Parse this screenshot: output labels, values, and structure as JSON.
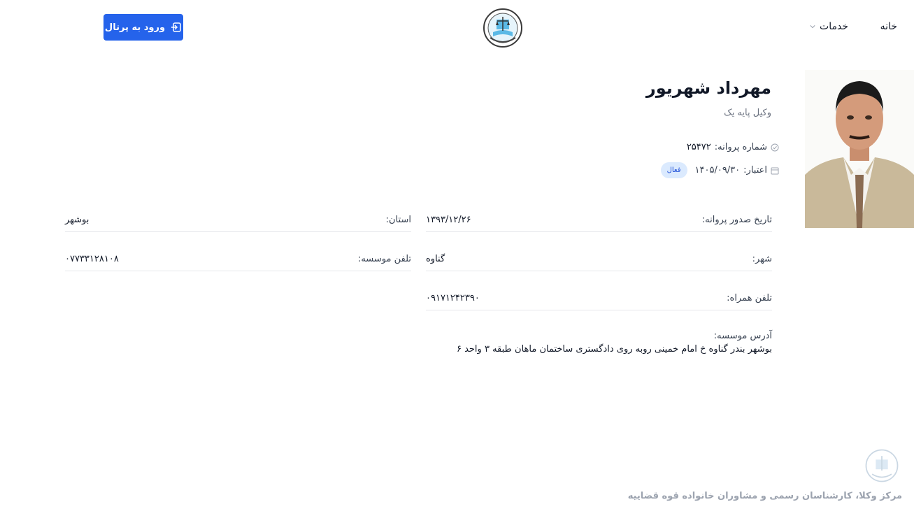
{
  "header": {
    "nav_home": "خانه",
    "nav_services": "خدمات",
    "portal_button": "ورود به پرتال",
    "accent_color": "#2563eb",
    "logo_icon": "judiciary-emblem-icon"
  },
  "profile": {
    "name": "مهرداد شهریور",
    "title": "وکیل پایه یک",
    "license_label": "شماره پروانه:",
    "license_value": "۲۵۴۷۲",
    "validity_label": "اعتبار:",
    "validity_value": "۱۴۰۵/۰۹/۳۰",
    "status_badge": "فعال"
  },
  "details": {
    "issue_date_label": "تاریخ صدور پروانه:",
    "issue_date_value": "۱۳۹۳/۱۲/۲۶",
    "province_label": "استان:",
    "province_value": "بوشهر",
    "city_label": "شهر:",
    "city_value": "گناوه",
    "office_phone_label": "تلفن موسسه:",
    "office_phone_value": "۰۷۷۳۳۱۲۸۱۰۸",
    "mobile_label": "تلفن همراه:",
    "mobile_value": "۰۹۱۷۱۲۴۲۳۹۰",
    "address_label": "آدرس موسسه:",
    "address_value": "بوشهر بندر گناوه خ امام خمینی روبه روی دادگستری ساختمان ماهان طبقه ۳ واحد ۶"
  },
  "footer": {
    "text": "مرکز وکلا، کارشناسان رسمی و مشاوران خانواده قوه قضاییه"
  }
}
